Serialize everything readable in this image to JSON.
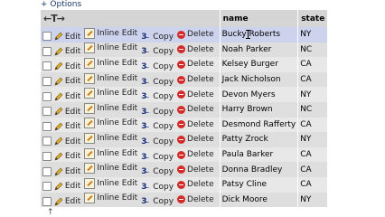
{
  "options_label": "+ Options",
  "header": {
    "arrows": "←T→",
    "name": "name",
    "state": "state"
  },
  "actions": {
    "edit": "Edit",
    "inline_edit": "Inline Edit",
    "copy": "Copy",
    "delete": "Delete"
  },
  "rows": [
    {
      "name": "Bucky Roberts",
      "state": "NY"
    },
    {
      "name": "Noah Parker",
      "state": "NC"
    },
    {
      "name": "Kelsey Burger",
      "state": "CA"
    },
    {
      "name": "Jack Nicholson",
      "state": "CA"
    },
    {
      "name": "Devon Myers",
      "state": "NY"
    },
    {
      "name": "Harry Brown",
      "state": "NC"
    },
    {
      "name": "Desmond Rafferty",
      "state": "CA"
    },
    {
      "name": "Patty Zrock",
      "state": "NY"
    },
    {
      "name": "Paula Barker",
      "state": "CA"
    },
    {
      "name": "Donna Bradley",
      "state": "CA"
    },
    {
      "name": "Patsy Cline",
      "state": "CA"
    },
    {
      "name": "Dick Moore",
      "state": "NY"
    }
  ],
  "icons": {
    "edit": "pencil-icon",
    "inline_edit": "inline-edit-icon",
    "copy": "copy-icon",
    "delete": "delete-icon"
  },
  "colors": {
    "header_bg": "#d5d5d5",
    "row_odd": "#e8e8e8",
    "row_even": "#dedede",
    "row_highlight": "#cdd3ec",
    "delete_red": "#d32a2a"
  }
}
